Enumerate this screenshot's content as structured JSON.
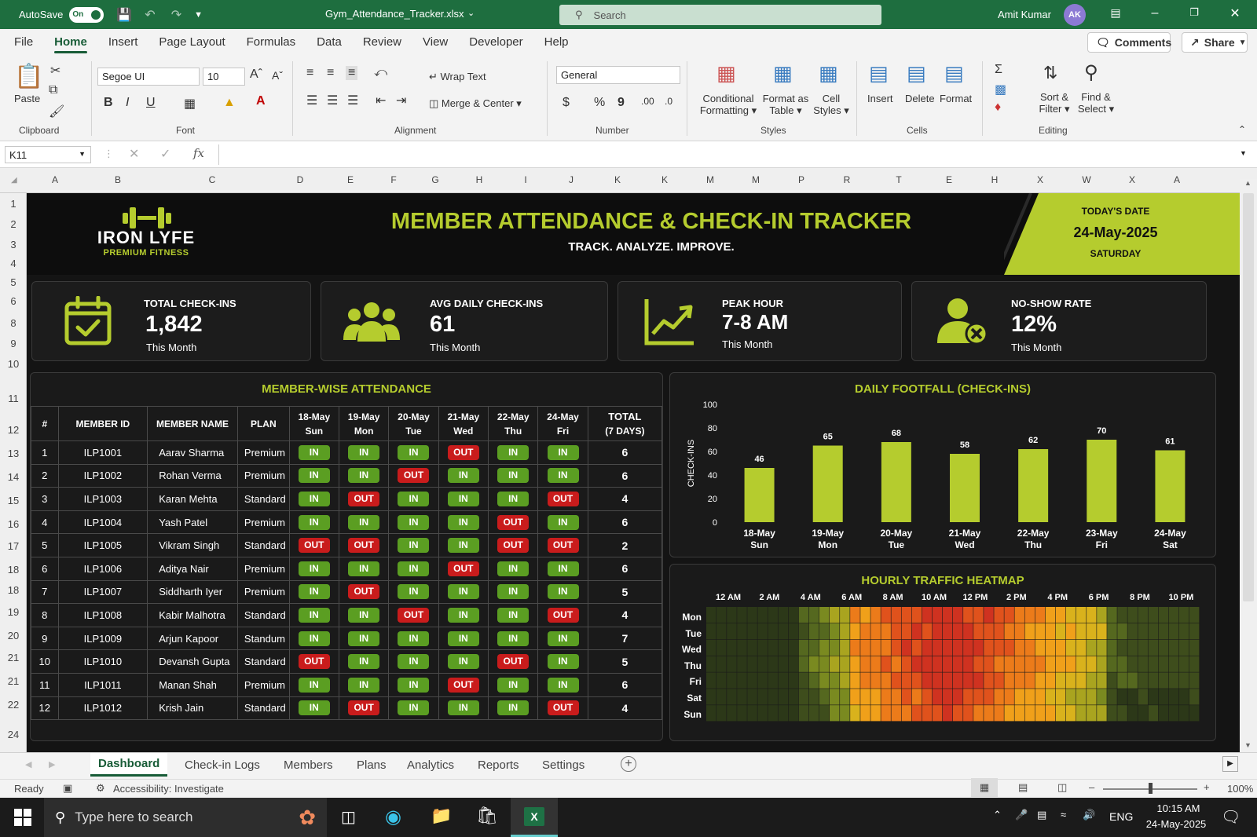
{
  "titlebar": {
    "autosave_label": "AutoSave",
    "autosave_state": "On",
    "filename": "Gym_Attendance_Tracker.xlsx",
    "search_placeholder": "Search",
    "user_name": "Amit Kumar",
    "user_initials": "AK"
  },
  "menu": {
    "tabs": [
      "File",
      "Home",
      "Insert",
      "Page Layout",
      "Formulas",
      "Data",
      "Review",
      "View",
      "Developer",
      "Help"
    ],
    "active": "Home",
    "comments_label": "Comments",
    "share_label": "Share"
  },
  "ribbon": {
    "clipboard": {
      "paste": "Paste",
      "label": "Clipboard"
    },
    "font": {
      "family": "Segoe UI",
      "size": "10",
      "label": "Font"
    },
    "alignment": {
      "wrap_text": "Wrap Text",
      "merge_center": "Merge & Center",
      "label": "Alignment"
    },
    "number": {
      "format": "General",
      "label": "Number"
    },
    "styles": {
      "conditional": "Conditional",
      "conditional2": "Formatting",
      "format_as": "Format as",
      "format_as2": "Table",
      "cell": "Cell",
      "cell2": "Styles",
      "label": "Styles"
    },
    "cells": {
      "insert": "Insert",
      "delete": "Delete",
      "format": "Format",
      "label": "Cells"
    },
    "editing": {
      "sort": "Sort &",
      "sort2": "Filter",
      "find": "Find &",
      "find2": "Select",
      "label": "Editing"
    }
  },
  "formula_bar": {
    "name_box": "K11",
    "content": ""
  },
  "columns": [
    "A",
    "B",
    "C",
    "D",
    "E",
    "F",
    "G",
    "H",
    "I",
    "J",
    "K",
    "K",
    "M",
    "M",
    "P",
    "R",
    "T",
    "E",
    "H",
    "X",
    "W",
    "X",
    "A"
  ],
  "rows": [
    "1",
    "2",
    "3",
    "4",
    "5",
    "6",
    "8",
    "9",
    "10",
    "11",
    "12",
    "13",
    "14",
    "15",
    "16",
    "17",
    "18",
    "18",
    "19",
    "20",
    "21",
    "21",
    "22",
    "24"
  ],
  "dashboard": {
    "brand_name": "IRON LYFE",
    "brand_tag": "PREMIUM FITNESS",
    "title": "MEMBER ATTENDANCE & CHECK-IN TRACKER",
    "subtitle": "TRACK. ANALYZE. IMPROVE.",
    "date_label": "TODAY'S DATE",
    "date_value": "24-May-2025",
    "day_value": "SATURDAY",
    "accent_color": "#b5cc2e",
    "kpis": [
      {
        "label": "TOTAL CHECK-INS",
        "value": "1,842",
        "sub": "This Month",
        "icon": "calendar-check-icon"
      },
      {
        "label": "AVG DAILY CHECK-INS",
        "value": "61",
        "sub": "This Month",
        "icon": "users-group-icon"
      },
      {
        "label": "PEAK HOUR",
        "value": "7-8 AM",
        "sub": "This Month",
        "icon": "trend-up-icon"
      },
      {
        "label": "NO-SHOW RATE",
        "value": "12%",
        "sub": "This Month",
        "icon": "user-x-icon"
      }
    ],
    "attendance": {
      "title": "MEMBER-WISE ATTENDANCE",
      "headers": [
        "#",
        "MEMBER ID",
        "MEMBER NAME",
        "PLAN"
      ],
      "day_headers": [
        [
          "18-May",
          "Sun"
        ],
        [
          "19-May",
          "Mon"
        ],
        [
          "20-May",
          "Tue"
        ],
        [
          "21-May",
          "Wed"
        ],
        [
          "22-May",
          "Thu"
        ],
        [
          "24-May",
          "Fri"
        ]
      ],
      "total_header": [
        "TOTAL",
        "(7 DAYS)"
      ],
      "rows": [
        {
          "n": "1",
          "id": "ILP1001",
          "name": "Aarav Sharma",
          "plan": "Premium",
          "days": [
            "IN",
            "IN",
            "IN",
            "OUT",
            "IN",
            "IN"
          ],
          "total": "6"
        },
        {
          "n": "2",
          "id": "ILP1002",
          "name": "Rohan Verma",
          "plan": "Premium",
          "days": [
            "IN",
            "IN",
            "OUT",
            "IN",
            "IN",
            "IN"
          ],
          "total": "6"
        },
        {
          "n": "3",
          "id": "ILP1003",
          "name": "Karan Mehta",
          "plan": "Standard",
          "days": [
            "IN",
            "OUT",
            "IN",
            "IN",
            "IN",
            "OUT"
          ],
          "total": "4"
        },
        {
          "n": "4",
          "id": "ILP1004",
          "name": "Yash Patel",
          "plan": "Premium",
          "days": [
            "IN",
            "IN",
            "IN",
            "IN",
            "OUT",
            "IN"
          ],
          "total": "6"
        },
        {
          "n": "5",
          "id": "ILP1005",
          "name": "Vikram Singh",
          "plan": "Standard",
          "days": [
            "OUT",
            "OUT",
            "IN",
            "IN",
            "OUT",
            "OUT"
          ],
          "total": "2"
        },
        {
          "n": "6",
          "id": "ILP1006",
          "name": "Aditya Nair",
          "plan": "Premium",
          "days": [
            "IN",
            "IN",
            "IN",
            "OUT",
            "IN",
            "IN"
          ],
          "total": "6"
        },
        {
          "n": "7",
          "id": "ILP1007",
          "name": "Siddharth Iyer",
          "plan": "Premium",
          "days": [
            "IN",
            "OUT",
            "IN",
            "IN",
            "IN",
            "IN"
          ],
          "total": "5"
        },
        {
          "n": "8",
          "id": "ILP1008",
          "name": "Kabir Malhotra",
          "plan": "Standard",
          "days": [
            "IN",
            "IN",
            "OUT",
            "IN",
            "IN",
            "OUT"
          ],
          "total": "4"
        },
        {
          "n": "9",
          "id": "ILP1009",
          "name": "Arjun Kapoor",
          "plan": "Standum",
          "days": [
            "IN",
            "IN",
            "IN",
            "IN",
            "IN",
            "IN"
          ],
          "total": "7"
        },
        {
          "n": "10",
          "id": "ILP1010",
          "name": "Devansh Gupta",
          "plan": "Standard",
          "days": [
            "OUT",
            "IN",
            "IN",
            "IN",
            "OUT",
            "IN"
          ],
          "total": "5"
        },
        {
          "n": "11",
          "id": "ILP1011",
          "name": "Manan Shah",
          "plan": "Premium",
          "days": [
            "IN",
            "IN",
            "IN",
            "OUT",
            "IN",
            "IN"
          ],
          "total": "6"
        },
        {
          "n": "12",
          "id": "ILP1012",
          "name": "Krish Jain",
          "plan": "Standard",
          "days": [
            "IN",
            "OUT",
            "IN",
            "IN",
            "IN",
            "OUT"
          ],
          "total": "4"
        }
      ]
    },
    "heatmap": {
      "title": "HOURLY TRAFFIC HEATMAP",
      "hour_labels": [
        "12 AM",
        "2 AM",
        "4 AM",
        "6 AM",
        "8 AM",
        "10 AM",
        "12 PM",
        "2 PM",
        "4 PM",
        "6 PM",
        "8 PM",
        "10 PM"
      ],
      "day_labels": [
        "Mon",
        "Tue",
        "Wed",
        "Thu",
        "Fri",
        "Sat",
        "Sun"
      ]
    }
  },
  "chart_data": {
    "type": "bar",
    "title": "DAILY FOOTFALL (CHECK-INS)",
    "ylabel": "CHECK-INS",
    "xlabel": "",
    "categories": [
      [
        "18-May",
        "Sun"
      ],
      [
        "19-May",
        "Mon"
      ],
      [
        "20-May",
        "Tue"
      ],
      [
        "21-May",
        "Wed"
      ],
      [
        "22-May",
        "Thu"
      ],
      [
        "23-May",
        "Fri"
      ],
      [
        "24-May",
        "Sat"
      ]
    ],
    "values": [
      46,
      65,
      68,
      58,
      62,
      70,
      61
    ],
    "ylim": [
      0,
      100
    ],
    "yticks": [
      0,
      20,
      40,
      60,
      80,
      100
    ],
    "bar_color": "#b5cc2e",
    "grid": false
  },
  "sheets": {
    "tabs": [
      "Dashboard",
      "Check-in Logs",
      "Members",
      "Plans",
      "Analytics",
      "Reports",
      "Settings"
    ],
    "active": "Dashboard"
  },
  "status": {
    "ready": "Ready",
    "accessibility": "Accessibility: Investigate",
    "zoom": "100%"
  },
  "taskbar": {
    "search_placeholder": "Type here to search",
    "lang": "ENG",
    "time": "10:15 AM",
    "date": "24-May-2025"
  }
}
